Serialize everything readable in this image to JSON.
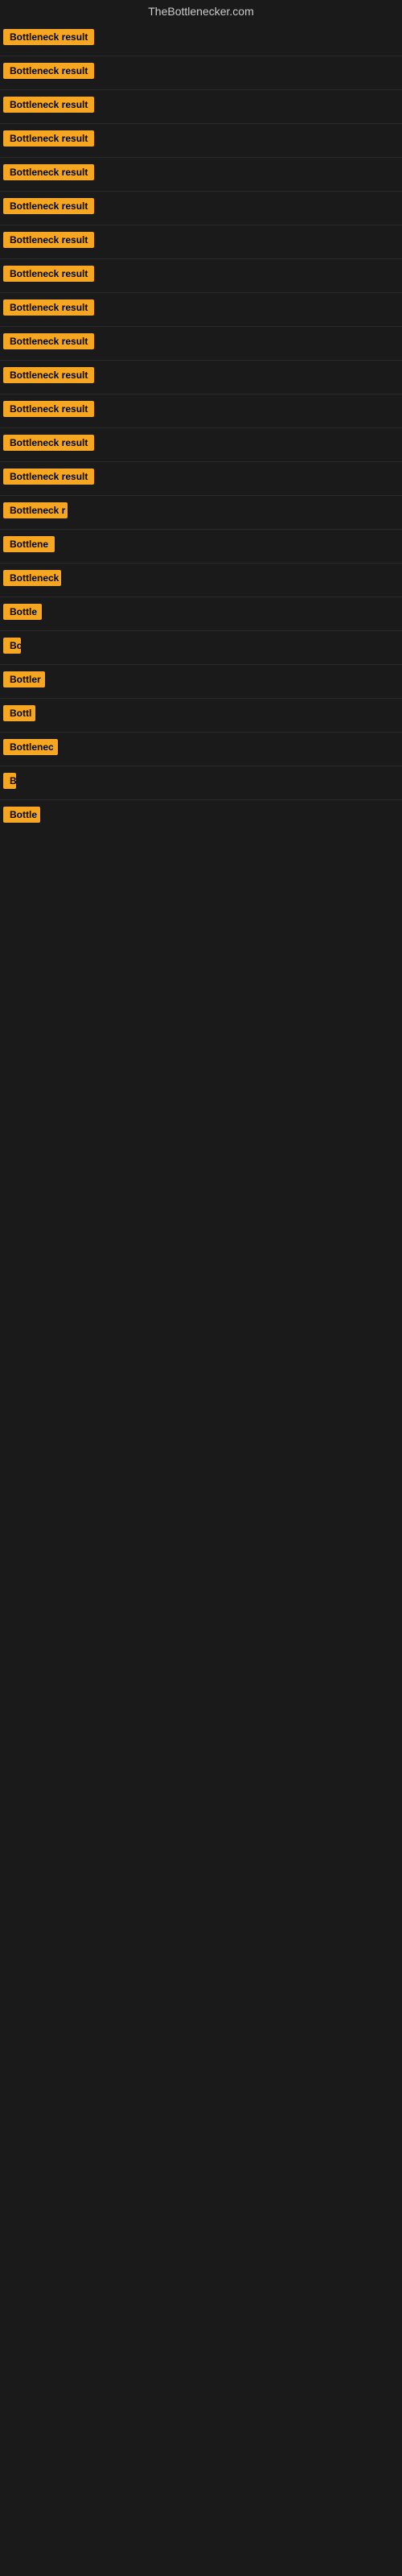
{
  "site": {
    "title": "TheBottlenecker.com"
  },
  "badges": [
    {
      "id": 1,
      "label": "Bottleneck result",
      "width": 120
    },
    {
      "id": 2,
      "label": "Bottleneck result",
      "width": 120
    },
    {
      "id": 3,
      "label": "Bottleneck result",
      "width": 120
    },
    {
      "id": 4,
      "label": "Bottleneck result",
      "width": 120
    },
    {
      "id": 5,
      "label": "Bottleneck result",
      "width": 120
    },
    {
      "id": 6,
      "label": "Bottleneck result",
      "width": 120
    },
    {
      "id": 7,
      "label": "Bottleneck result",
      "width": 120
    },
    {
      "id": 8,
      "label": "Bottleneck result",
      "width": 120
    },
    {
      "id": 9,
      "label": "Bottleneck result",
      "width": 120
    },
    {
      "id": 10,
      "label": "Bottleneck result",
      "width": 120
    },
    {
      "id": 11,
      "label": "Bottleneck result",
      "width": 120
    },
    {
      "id": 12,
      "label": "Bottleneck result",
      "width": 116
    },
    {
      "id": 13,
      "label": "Bottleneck result",
      "width": 116
    },
    {
      "id": 14,
      "label": "Bottleneck result",
      "width": 116
    },
    {
      "id": 15,
      "label": "Bottleneck r",
      "width": 80
    },
    {
      "id": 16,
      "label": "Bottlene",
      "width": 64
    },
    {
      "id": 17,
      "label": "Bottleneck",
      "width": 72
    },
    {
      "id": 18,
      "label": "Bottle",
      "width": 48
    },
    {
      "id": 19,
      "label": "Bo",
      "width": 22
    },
    {
      "id": 20,
      "label": "Bottler",
      "width": 52
    },
    {
      "id": 21,
      "label": "Bottl",
      "width": 40
    },
    {
      "id": 22,
      "label": "Bottlenec",
      "width": 68
    },
    {
      "id": 23,
      "label": "B",
      "width": 12
    },
    {
      "id": 24,
      "label": "Bottle",
      "width": 46
    }
  ]
}
